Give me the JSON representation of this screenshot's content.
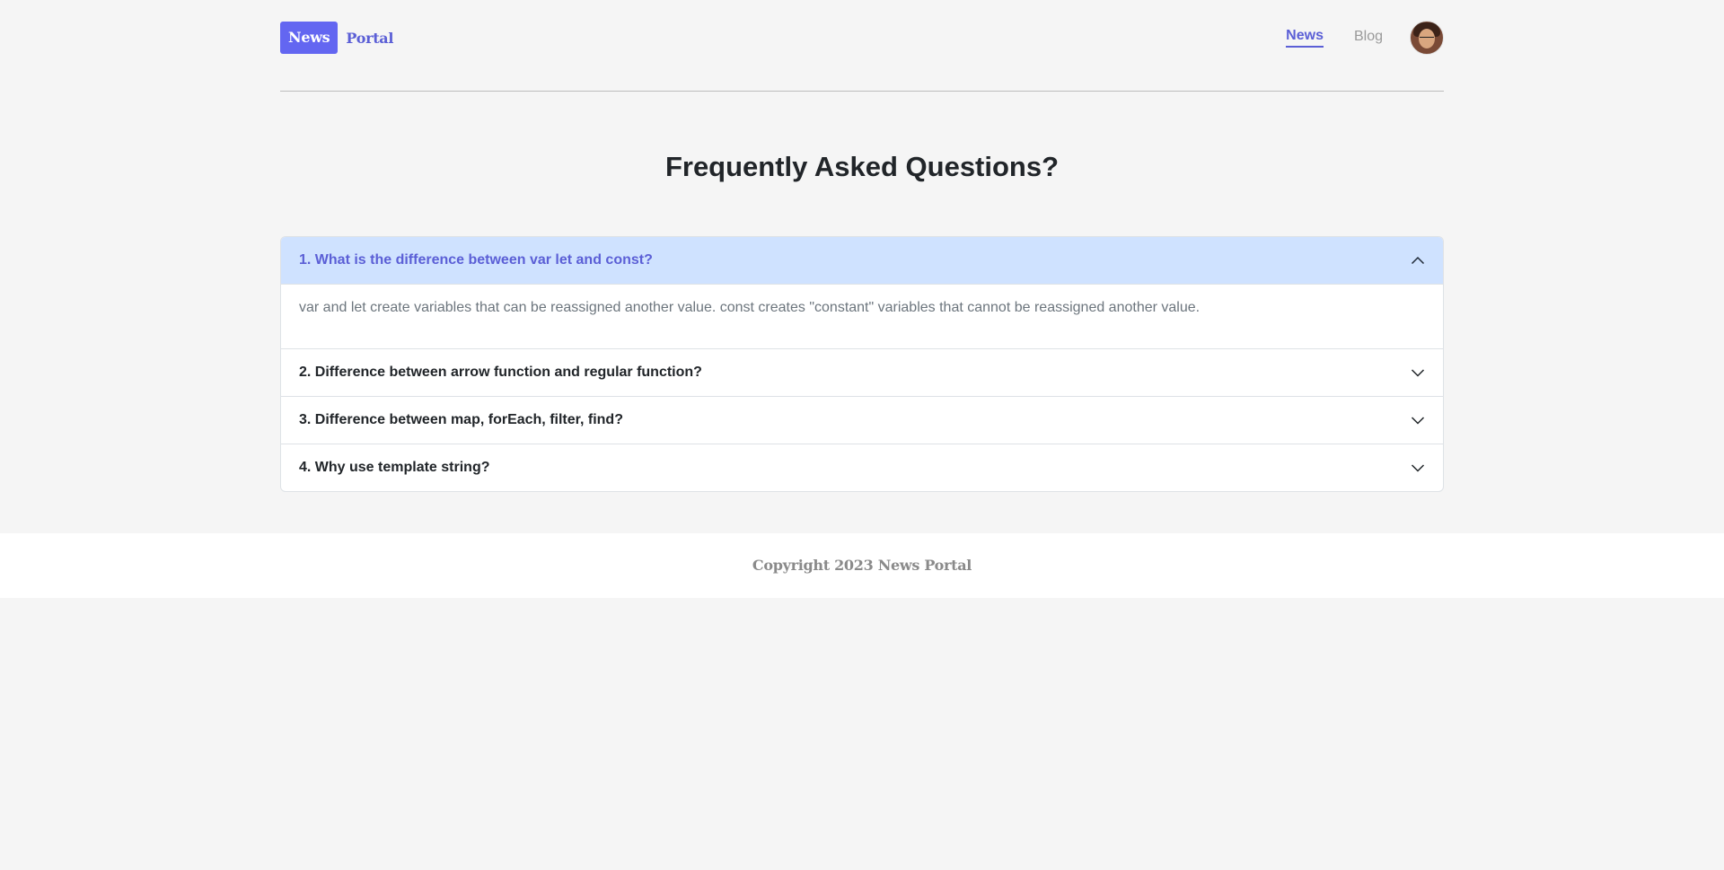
{
  "header": {
    "logo_badge": "News",
    "logo_text": "Portal",
    "nav": [
      {
        "label": "News",
        "active": true
      },
      {
        "label": "Blog",
        "active": false
      }
    ],
    "avatar_icon": "user-avatar"
  },
  "main": {
    "title": "Frequently Asked Questions?",
    "faq": [
      {
        "question": "1. What is the difference between var let and const?",
        "answer": "var and let create variables that can be reassigned another value. const creates \"constant\" variables that cannot be reassigned another value.",
        "open": true
      },
      {
        "question": "2. Difference between arrow function and regular function?",
        "open": false
      },
      {
        "question": "3. Difference between map, forEach, filter, find?",
        "open": false
      },
      {
        "question": "4. Why use template string?",
        "open": false
      }
    ]
  },
  "footer": {
    "copyright": "Copyright 2023 News Portal"
  },
  "colors": {
    "accent": "#6366f1",
    "open_header_bg": "#cfe2ff",
    "background": "#f5f5f5"
  }
}
